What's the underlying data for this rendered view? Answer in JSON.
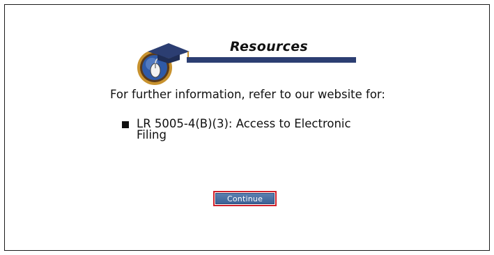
{
  "header": {
    "title": "Resources",
    "logo_icon": "graduation-cap-mouse-icon",
    "accent_bar_color": "#2c3e72"
  },
  "content": {
    "intro": "For further information, refer to our website for:",
    "links": [
      {
        "label": "LR 5005-4(B)(3): Access to Electronic Filing"
      }
    ]
  },
  "actions": {
    "continue_label": "Continue",
    "continue_color": "#3d6296",
    "focus_outline_color": "#d0202a"
  }
}
